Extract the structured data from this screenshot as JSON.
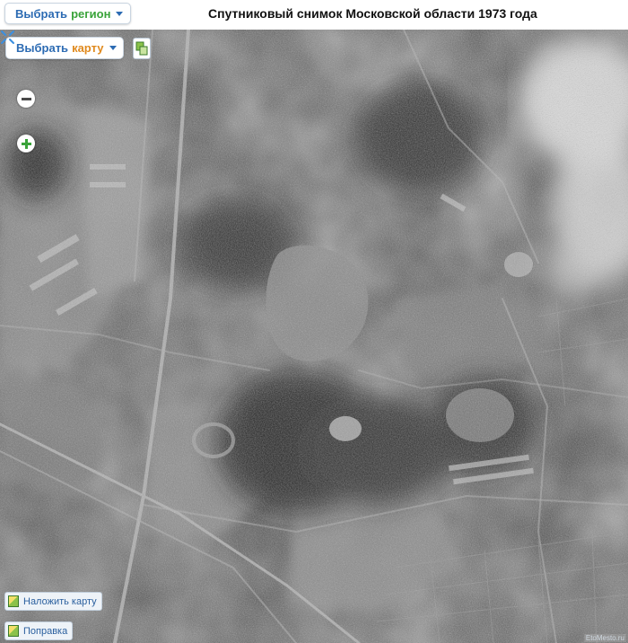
{
  "header": {
    "region_button": {
      "label": "Выбрать",
      "accent": "регион"
    },
    "title": "Спутниковый снимок Московской области 1973 года"
  },
  "map_controls": {
    "map_button": {
      "label": "Выбрать",
      "accent": "карту"
    },
    "overlay_button": "Наложить карту",
    "correction_button": "Поправка"
  },
  "copyright": "EtoMesto.ru",
  "colors": {
    "link_blue": "#2c6bb3",
    "accent_green": "#3aa33a",
    "accent_orange": "#e08a1e"
  }
}
